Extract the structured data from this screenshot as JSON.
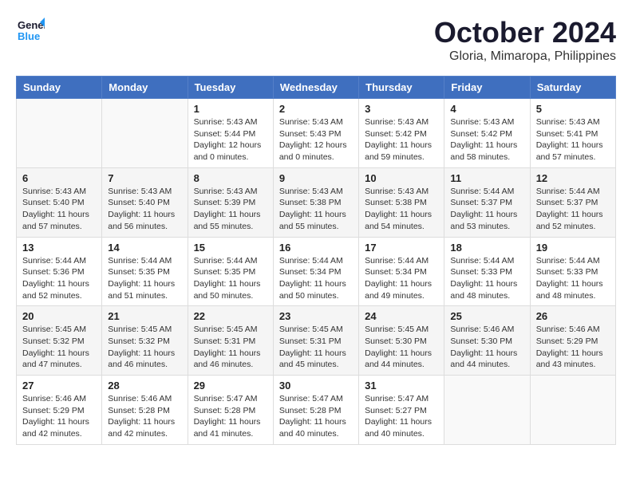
{
  "header": {
    "logo_general": "General",
    "logo_blue": "Blue",
    "month_title": "October 2024",
    "location": "Gloria, Mimaropa, Philippines"
  },
  "columns": [
    "Sunday",
    "Monday",
    "Tuesday",
    "Wednesday",
    "Thursday",
    "Friday",
    "Saturday"
  ],
  "weeks": [
    [
      {
        "day": "",
        "info": ""
      },
      {
        "day": "",
        "info": ""
      },
      {
        "day": "1",
        "info": "Sunrise: 5:43 AM\nSunset: 5:44 PM\nDaylight: 12 hours\nand 0 minutes."
      },
      {
        "day": "2",
        "info": "Sunrise: 5:43 AM\nSunset: 5:43 PM\nDaylight: 12 hours\nand 0 minutes."
      },
      {
        "day": "3",
        "info": "Sunrise: 5:43 AM\nSunset: 5:42 PM\nDaylight: 11 hours\nand 59 minutes."
      },
      {
        "day": "4",
        "info": "Sunrise: 5:43 AM\nSunset: 5:42 PM\nDaylight: 11 hours\nand 58 minutes."
      },
      {
        "day": "5",
        "info": "Sunrise: 5:43 AM\nSunset: 5:41 PM\nDaylight: 11 hours\nand 57 minutes."
      }
    ],
    [
      {
        "day": "6",
        "info": "Sunrise: 5:43 AM\nSunset: 5:40 PM\nDaylight: 11 hours\nand 57 minutes."
      },
      {
        "day": "7",
        "info": "Sunrise: 5:43 AM\nSunset: 5:40 PM\nDaylight: 11 hours\nand 56 minutes."
      },
      {
        "day": "8",
        "info": "Sunrise: 5:43 AM\nSunset: 5:39 PM\nDaylight: 11 hours\nand 55 minutes."
      },
      {
        "day": "9",
        "info": "Sunrise: 5:43 AM\nSunset: 5:38 PM\nDaylight: 11 hours\nand 55 minutes."
      },
      {
        "day": "10",
        "info": "Sunrise: 5:43 AM\nSunset: 5:38 PM\nDaylight: 11 hours\nand 54 minutes."
      },
      {
        "day": "11",
        "info": "Sunrise: 5:44 AM\nSunset: 5:37 PM\nDaylight: 11 hours\nand 53 minutes."
      },
      {
        "day": "12",
        "info": "Sunrise: 5:44 AM\nSunset: 5:37 PM\nDaylight: 11 hours\nand 52 minutes."
      }
    ],
    [
      {
        "day": "13",
        "info": "Sunrise: 5:44 AM\nSunset: 5:36 PM\nDaylight: 11 hours\nand 52 minutes."
      },
      {
        "day": "14",
        "info": "Sunrise: 5:44 AM\nSunset: 5:35 PM\nDaylight: 11 hours\nand 51 minutes."
      },
      {
        "day": "15",
        "info": "Sunrise: 5:44 AM\nSunset: 5:35 PM\nDaylight: 11 hours\nand 50 minutes."
      },
      {
        "day": "16",
        "info": "Sunrise: 5:44 AM\nSunset: 5:34 PM\nDaylight: 11 hours\nand 50 minutes."
      },
      {
        "day": "17",
        "info": "Sunrise: 5:44 AM\nSunset: 5:34 PM\nDaylight: 11 hours\nand 49 minutes."
      },
      {
        "day": "18",
        "info": "Sunrise: 5:44 AM\nSunset: 5:33 PM\nDaylight: 11 hours\nand 48 minutes."
      },
      {
        "day": "19",
        "info": "Sunrise: 5:44 AM\nSunset: 5:33 PM\nDaylight: 11 hours\nand 48 minutes."
      }
    ],
    [
      {
        "day": "20",
        "info": "Sunrise: 5:45 AM\nSunset: 5:32 PM\nDaylight: 11 hours\nand 47 minutes."
      },
      {
        "day": "21",
        "info": "Sunrise: 5:45 AM\nSunset: 5:32 PM\nDaylight: 11 hours\nand 46 minutes."
      },
      {
        "day": "22",
        "info": "Sunrise: 5:45 AM\nSunset: 5:31 PM\nDaylight: 11 hours\nand 46 minutes."
      },
      {
        "day": "23",
        "info": "Sunrise: 5:45 AM\nSunset: 5:31 PM\nDaylight: 11 hours\nand 45 minutes."
      },
      {
        "day": "24",
        "info": "Sunrise: 5:45 AM\nSunset: 5:30 PM\nDaylight: 11 hours\nand 44 minutes."
      },
      {
        "day": "25",
        "info": "Sunrise: 5:46 AM\nSunset: 5:30 PM\nDaylight: 11 hours\nand 44 minutes."
      },
      {
        "day": "26",
        "info": "Sunrise: 5:46 AM\nSunset: 5:29 PM\nDaylight: 11 hours\nand 43 minutes."
      }
    ],
    [
      {
        "day": "27",
        "info": "Sunrise: 5:46 AM\nSunset: 5:29 PM\nDaylight: 11 hours\nand 42 minutes."
      },
      {
        "day": "28",
        "info": "Sunrise: 5:46 AM\nSunset: 5:28 PM\nDaylight: 11 hours\nand 42 minutes."
      },
      {
        "day": "29",
        "info": "Sunrise: 5:47 AM\nSunset: 5:28 PM\nDaylight: 11 hours\nand 41 minutes."
      },
      {
        "day": "30",
        "info": "Sunrise: 5:47 AM\nSunset: 5:28 PM\nDaylight: 11 hours\nand 40 minutes."
      },
      {
        "day": "31",
        "info": "Sunrise: 5:47 AM\nSunset: 5:27 PM\nDaylight: 11 hours\nand 40 minutes."
      },
      {
        "day": "",
        "info": ""
      },
      {
        "day": "",
        "info": ""
      }
    ]
  ]
}
